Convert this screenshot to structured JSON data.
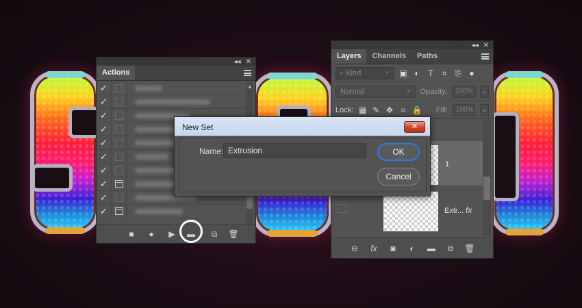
{
  "actions_panel": {
    "tab_label": "Actions",
    "collapse_glyph": "◂◂",
    "close_glyph": "✕",
    "check_glyph": "✓",
    "rows": [
      {
        "checked": true,
        "toggle": "box"
      },
      {
        "checked": true,
        "toggle": "box"
      },
      {
        "checked": true,
        "toggle": "box"
      },
      {
        "checked": true,
        "toggle": "box"
      },
      {
        "checked": true,
        "toggle": "box"
      },
      {
        "checked": true,
        "toggle": "box"
      },
      {
        "checked": true,
        "toggle": "box"
      },
      {
        "checked": true,
        "toggle": "dialog"
      },
      {
        "checked": true,
        "toggle": "box"
      },
      {
        "checked": true,
        "toggle": "dialog"
      }
    ],
    "toolbar": {
      "stop_glyph": "■",
      "record_glyph": "●",
      "play_glyph": "▶",
      "new_set_glyph": "▬",
      "new_action_glyph": "⧉",
      "delete_glyph": "🗑"
    }
  },
  "layers_panel": {
    "tabs": [
      "Layers",
      "Channels",
      "Paths"
    ],
    "collapse_glyph": "◂◂",
    "close_glyph": "✕",
    "kind_placeholder": "⌕ Kind",
    "blend_mode": "Normal",
    "opacity_label": "Opacity:",
    "opacity_value": "100%",
    "lock_label": "Lock:",
    "fill_label": "Fill:",
    "fill_value": "100%",
    "layers": [
      {
        "name": "1",
        "selected": true
      },
      {
        "name": "Extr...",
        "selected": false,
        "fx": "fx"
      }
    ],
    "toolbar": {
      "link_glyph": "⊖",
      "fx_glyph": "fx",
      "mask_glyph": "◙",
      "adjust_glyph": "◐",
      "group_glyph": "▬",
      "new_glyph": "⧉",
      "delete_glyph": "🗑"
    }
  },
  "dialog": {
    "title": "New Set",
    "close_glyph": "✕",
    "name_label": "Name:",
    "name_value": "Extrusion",
    "ok_label": "OK",
    "cancel_label": "Cancel"
  },
  "colors": {
    "panel_bg": "#535353",
    "dialog_title_bg": "#c4d8ef",
    "ok_border": "#2c7de0",
    "close_red": "#c9452d"
  }
}
